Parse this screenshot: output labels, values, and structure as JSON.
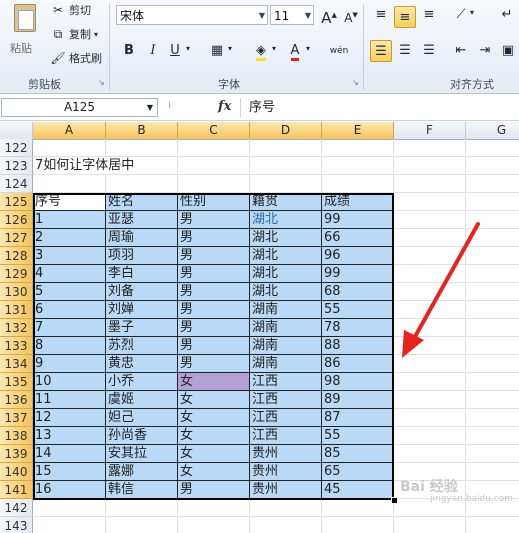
{
  "clipboard": {
    "paste_label": "粘贴",
    "cut_label": "剪切",
    "copy_label": "复制",
    "format_painter_label": "格式刷",
    "group_label": "剪贴板"
  },
  "font": {
    "name": "宋体",
    "size": "11",
    "grow_label": "A",
    "shrink_label": "A",
    "bold": "B",
    "italic": "I",
    "underline": "U",
    "font_color_glyph": "A",
    "wen_label": "wén",
    "group_label": "字体"
  },
  "alignment": {
    "group_label": "对齐方式"
  },
  "formula_bar": {
    "name_box": "A125",
    "fx": "fx",
    "content": "序号"
  },
  "columns": [
    "A",
    "B",
    "C",
    "D",
    "E",
    "F",
    "G"
  ],
  "row_numbers": [
    "122",
    "123",
    "124",
    "125",
    "126",
    "127",
    "128",
    "129",
    "130",
    "131",
    "132",
    "133",
    "134",
    "135",
    "136",
    "137",
    "138",
    "139",
    "140",
    "141",
    "142",
    "143"
  ],
  "title_cell": "7如何让字体居中",
  "table": {
    "headers": [
      "序号",
      "姓名",
      "性别",
      "籍贯",
      "成绩"
    ],
    "rows": [
      [
        "1",
        "亚瑟",
        "男",
        "湖北",
        "99"
      ],
      [
        "2",
        "周瑜",
        "男",
        "湖北",
        "66"
      ],
      [
        "3",
        "项羽",
        "男",
        "湖北",
        "96"
      ],
      [
        "4",
        "李白",
        "男",
        "湖北",
        "99"
      ],
      [
        "5",
        "刘备",
        "男",
        "湖北",
        "68"
      ],
      [
        "6",
        "刘婵",
        "男",
        "湖南",
        "55"
      ],
      [
        "7",
        "墨子",
        "男",
        "湖南",
        "78"
      ],
      [
        "8",
        "苏烈",
        "男",
        "湖南",
        "88"
      ],
      [
        "9",
        "黄忠",
        "男",
        "湖南",
        "86"
      ],
      [
        "10",
        "小乔",
        "女",
        "江西",
        "98"
      ],
      [
        "11",
        "虞姬",
        "女",
        "江西",
        "89"
      ],
      [
        "12",
        "妲己",
        "女",
        "江西",
        "87"
      ],
      [
        "13",
        "孙尚香",
        "女",
        "江西",
        "55"
      ],
      [
        "14",
        "安其拉",
        "女",
        "贵州",
        "85"
      ],
      [
        "15",
        "露娜",
        "女",
        "贵州",
        "65"
      ],
      [
        "16",
        "韩信",
        "男",
        "贵州",
        "45"
      ]
    ]
  },
  "watermark": "Bai 经验",
  "watermark_sub": "jingyan.baidu.com",
  "colors": {
    "selection_fill": "#b9d9f7",
    "highlight_cell": "#b3a0d6",
    "arrow": "#e8231b",
    "header_selected": "#f6c45a",
    "hubei_text": "#2e6da4"
  }
}
